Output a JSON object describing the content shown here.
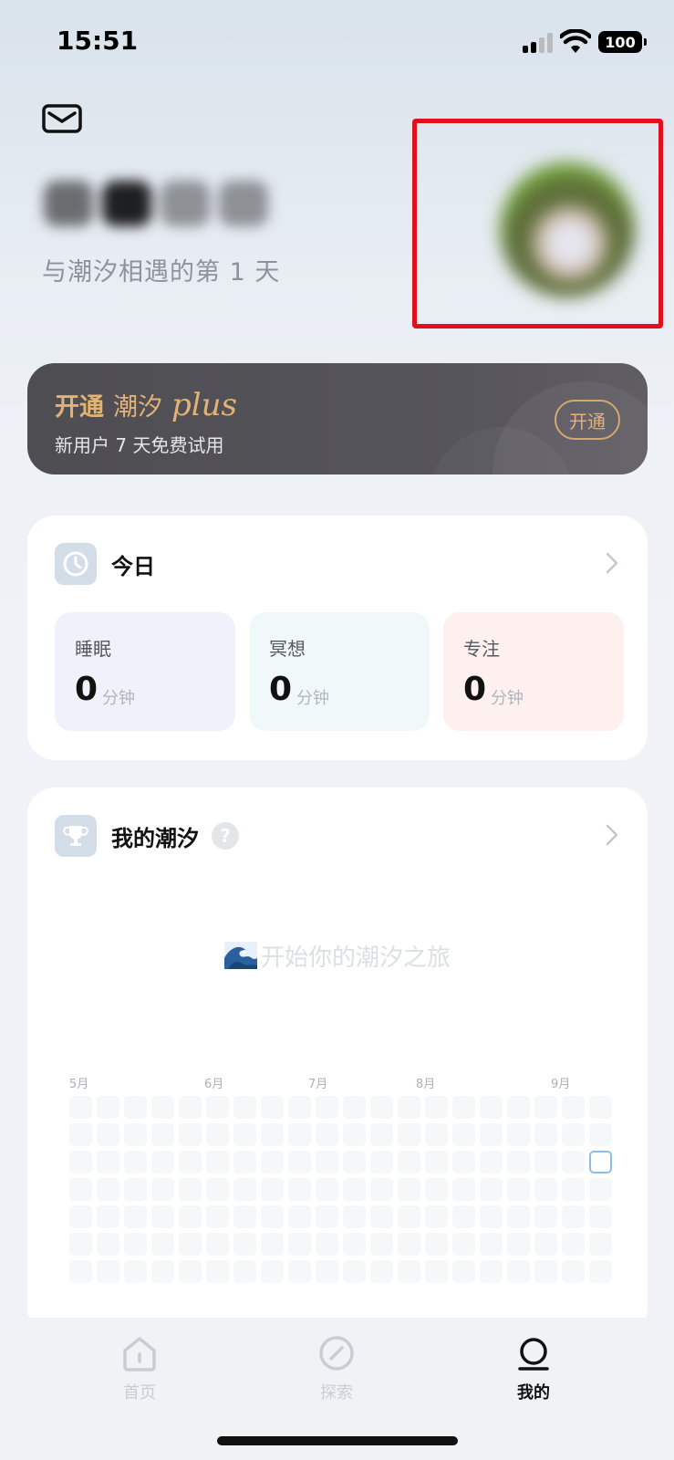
{
  "status_bar": {
    "time": "15:51",
    "battery": "100"
  },
  "header": {
    "mail_icon": "mail-icon",
    "days_text": "与潮汐相遇的第 1 天"
  },
  "plus_banner": {
    "title_open": "开通",
    "title_brand": "潮汐",
    "title_plus": "plus",
    "subtitle": "新用户 7 天免费试用",
    "button": "开通",
    "accent_color": "#e3b276"
  },
  "today_card": {
    "title": "今日",
    "icon": "clock-icon",
    "stats": [
      {
        "label": "睡眠",
        "value": "0",
        "unit": "分钟"
      },
      {
        "label": "冥想",
        "value": "0",
        "unit": "分钟"
      },
      {
        "label": "专注",
        "value": "0",
        "unit": "分钟"
      }
    ]
  },
  "tide_card": {
    "title": "我的潮汐",
    "icon": "trophy-icon",
    "help": "?",
    "empty_text": "开始你的潮汐之旅",
    "months": [
      "5月",
      "6月",
      "7月",
      "8月",
      "9月"
    ]
  },
  "tab_bar": {
    "tabs": [
      {
        "label": "首页",
        "icon": "home-icon"
      },
      {
        "label": "探索",
        "icon": "compass-icon"
      },
      {
        "label": "我的",
        "icon": "profile-icon"
      }
    ],
    "active_tab": "我的"
  }
}
